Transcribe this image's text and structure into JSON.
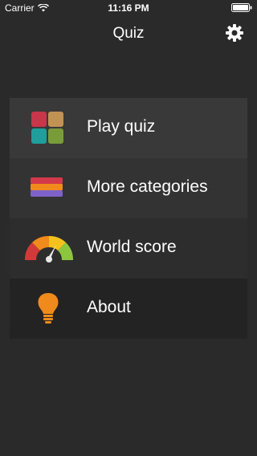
{
  "status_bar": {
    "carrier": "Carrier",
    "time": "11:16 PM"
  },
  "nav": {
    "title": "Quiz",
    "settings_icon": "gear-icon"
  },
  "menu": {
    "items": [
      {
        "label": "Play quiz",
        "icon": "tiles-grid-icon",
        "bg": "#393939"
      },
      {
        "label": "More categories",
        "icon": "stacked-bars-icon",
        "bg": "#333333"
      },
      {
        "label": "World score",
        "icon": "gauge-icon",
        "bg": "#2d2d2d"
      },
      {
        "label": "About",
        "icon": "lightbulb-icon",
        "bg": "#232323"
      }
    ]
  },
  "colors": {
    "background": "#2a2a2a",
    "tile_red": "#c8364a",
    "tile_tan": "#c29255",
    "tile_teal": "#1f9e9c",
    "tile_green": "#7a9b3a",
    "bulb_orange": "#f08a1c"
  }
}
